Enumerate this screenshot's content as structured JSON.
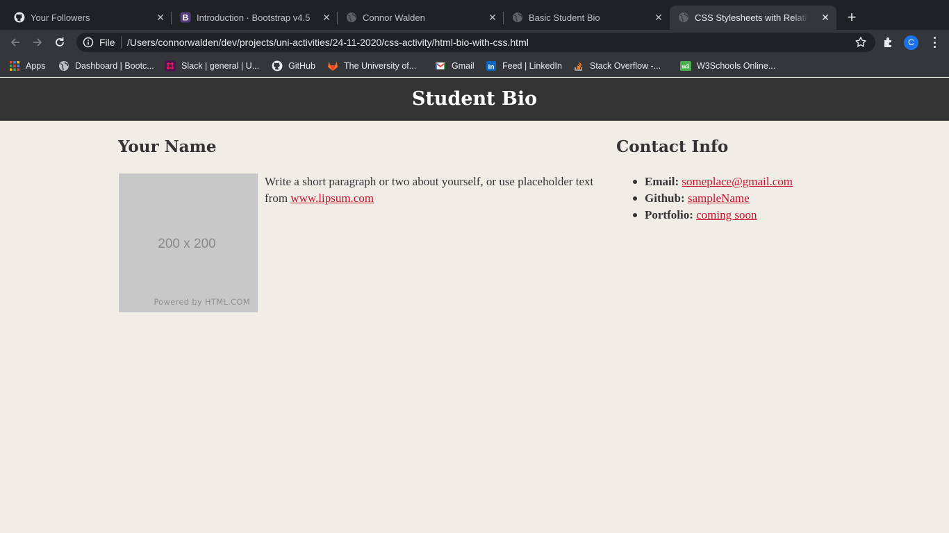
{
  "browser": {
    "tabs": [
      {
        "title": "Your Followers",
        "icon": "github-icon"
      },
      {
        "title": "Introduction · Bootstrap v4.5",
        "icon": "bootstrap-icon"
      },
      {
        "title": "Connor Walden",
        "icon": "globe-icon"
      },
      {
        "title": "Basic Student Bio",
        "icon": "globe-icon"
      },
      {
        "title": "CSS Stylesheets with Relative Paths",
        "icon": "globe-icon",
        "active": true
      }
    ],
    "new_tab_label": "+",
    "address": {
      "scheme": "File",
      "url": "/Users/connorwalden/dev/projects/uni-activities/24-11-2020/css-activity/html-bio-with-css.html"
    },
    "profile_initial": "C",
    "bookmarks": [
      {
        "label": "Apps",
        "icon": "apps-grid-icon"
      },
      {
        "label": "Dashboard | Bootc...",
        "icon": "globe-icon"
      },
      {
        "label": "Slack | general | U...",
        "icon": "slack-icon"
      },
      {
        "label": "GitHub",
        "icon": "github-icon"
      },
      {
        "label": "The University of...",
        "icon": "gitlab-icon"
      },
      {
        "label": "Gmail",
        "icon": "gmail-icon"
      },
      {
        "label": "Feed | LinkedIn",
        "icon": "linkedin-icon"
      },
      {
        "label": "Stack Overflow -...",
        "icon": "stackoverflow-icon"
      },
      {
        "label": "W3Schools Online...",
        "icon": "w3schools-icon"
      }
    ]
  },
  "page": {
    "header_title": "Student Bio",
    "name_heading": "Your Name",
    "image": {
      "size_text": "200 x 200",
      "powered_text": "Powered by HTML.COM"
    },
    "bio_text": "Write a short paragraph or two about yourself, or use placeholder text from ",
    "bio_link": "www.lipsum.com",
    "contact_heading": "Contact Info",
    "contacts": [
      {
        "label": "Email:",
        "value": "someplace@gmail.com"
      },
      {
        "label": "Github:",
        "value": "sampleName"
      },
      {
        "label": "Portfolio:",
        "value": "coming soon"
      }
    ]
  },
  "colors": {
    "link": "#c8102e",
    "header_bg": "#333333",
    "page_bg": "#efede6",
    "chrome_dark": "#202124"
  }
}
